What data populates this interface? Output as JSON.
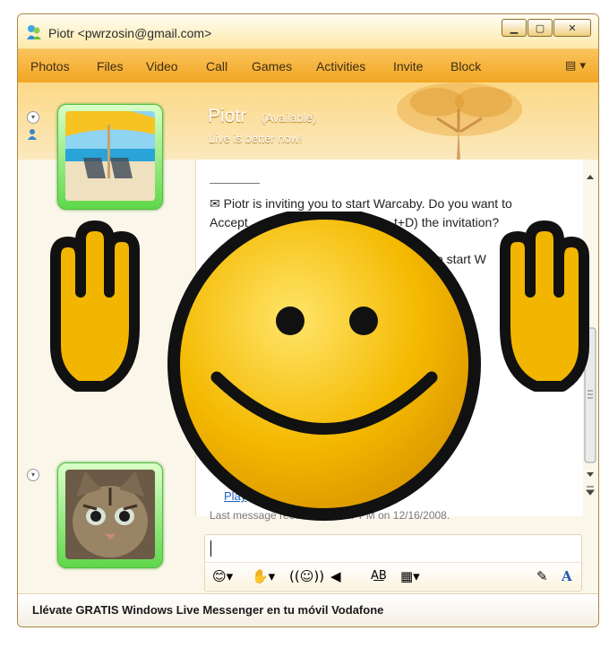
{
  "window": {
    "title": "Piotr <pwrzosin@gmail.com>",
    "controls": [
      "minimize",
      "maximize",
      "close"
    ]
  },
  "menu": {
    "items": [
      "Photos",
      "Files",
      "Video",
      "Call",
      "Games",
      "Activities",
      "Invite",
      "Block"
    ],
    "overflow_icon": "options-menu-icon"
  },
  "contact": {
    "name": "Piotr",
    "status": "(Available)",
    "personal_message": "Live is better now!"
  },
  "conversation": {
    "invite_line1": "Piotr is inviting you to start Warcaby. Do you want to",
    "invite_line2_left": "Accept",
    "invite_line2_right": "t+D) the invitation?",
    "partial_line_left": "",
    "partial_line_right": "to start W",
    "play_link": "Play",
    "last_message": "Last message received at 3:17 PM on 12/16/2008."
  },
  "input": {
    "value": ""
  },
  "toolbar": {
    "icons": [
      "emoticon-icon",
      "wink-icon",
      "nudge-icon",
      "voice-clip-icon",
      "spell-check-icon",
      "background-icon",
      "pen-icon",
      "font-icon"
    ]
  },
  "footer": {
    "ad_text": "Llévate GRATIS Windows Live Messenger en tu móvil Vodafone"
  },
  "colors": {
    "menubar": "#f1a521",
    "banner": "#fcd987",
    "avatar_glow": "#5fd84a",
    "link": "#1f5fc2",
    "smiley_face": "#f4b900"
  }
}
